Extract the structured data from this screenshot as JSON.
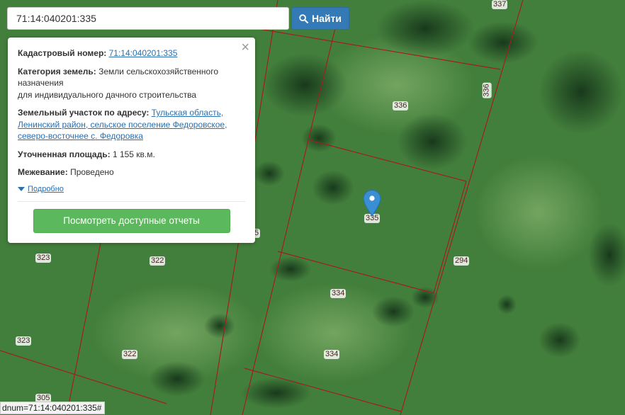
{
  "search": {
    "value": "71:14:040201:335",
    "button_label": "Найти"
  },
  "info": {
    "cadastral_label": "Кадастровый номер:",
    "cadastral_value": "71:14:040201:335",
    "category_label": "Категория земель:",
    "category_line1": "Земли сельскохозяйственного",
    "category_line2": "назначения",
    "category_line3": "для индивидуального дачного строительства",
    "address_label": "Земельный участок по адресу:",
    "address_line1": "Тульская область,",
    "address_line2": "Ленинский район, сельское поселение Федоровское,",
    "address_line3": "северо-восточнее с. Федоровка",
    "area_label": "Уточненная площадь:",
    "area_value": "1 155 кв.м.",
    "survey_label": "Межевание:",
    "survey_value": "Проведено",
    "details_label": "Подробно",
    "reports_button": "Посмотреть доступные отчеты",
    "close": "×"
  },
  "parcels": [
    "337",
    "336",
    "336",
    "335",
    "334",
    "334",
    "294",
    "323",
    "323",
    "322",
    "322",
    "305",
    "5"
  ],
  "status_bar": "dnum=71:14:040201:335#",
  "colors": {
    "boundary": "#a11f1f",
    "marker": "#3a8fd4",
    "search_button": "#337ab7",
    "reports_button": "#5cb85c",
    "link": "#2a6fb0"
  },
  "icons": [
    "search-icon",
    "close-icon",
    "caret-down-icon",
    "map-marker-icon"
  ]
}
